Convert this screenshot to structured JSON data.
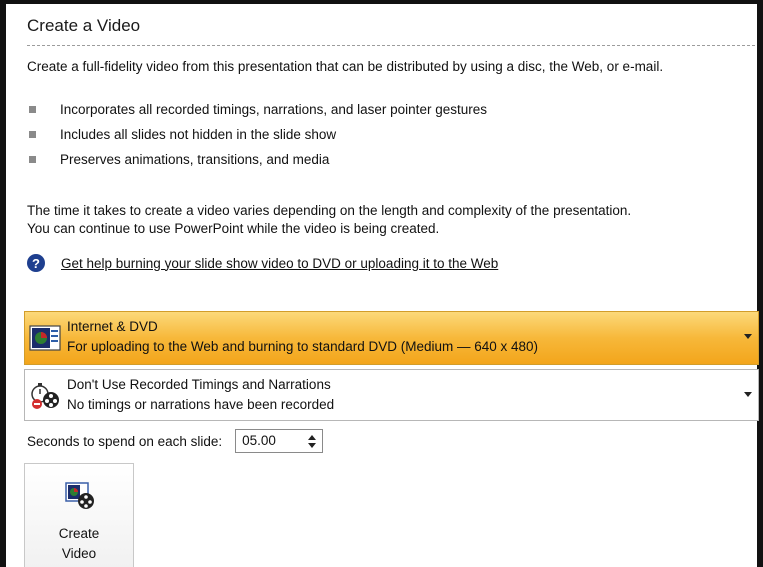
{
  "panel": {
    "title": "Create a Video",
    "description": "Create a full-fidelity video from this presentation that can be distributed by using a disc, the Web, or e-mail.",
    "bullets": [
      "Incorporates all recorded timings, narrations, and laser pointer gestures",
      "Includes all slides not hidden in the slide show",
      "Preserves animations, transitions, and media"
    ],
    "time_note_line1": "The time it takes to create a video varies depending on the length and complexity of the presentation.",
    "time_note_line2": "You can continue to use PowerPoint while the video is being created.",
    "help_icon": "help-question-icon",
    "help_link": "Get help burning your slide show video to DVD or uploading it to the Web"
  },
  "quality_dropdown": {
    "icon": "monitor-slide-icon",
    "title": "Internet & DVD",
    "subtitle": "For uploading to the Web and burning to standard DVD  (Medium — 640 x 480)",
    "highlight_color": "#f7b83a"
  },
  "timings_dropdown": {
    "icon": "stopwatch-film-icon",
    "title": "Don't Use Recorded Timings and Narrations",
    "subtitle": "No timings or narrations have been recorded"
  },
  "seconds": {
    "label": "Seconds to spend on each slide:",
    "value": "05.00"
  },
  "create_button": {
    "icon": "create-video-icon",
    "line1": "Create",
    "line2": "Video"
  }
}
